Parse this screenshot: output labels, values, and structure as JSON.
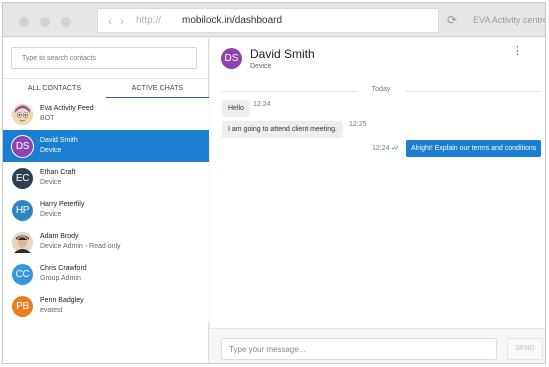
{
  "browser": {
    "back_glyph": "‹",
    "forward_glyph": "›",
    "protocol": "http://",
    "url": "mobilock.in/dashboard",
    "refresh_glyph": "⟳",
    "title": "EVA Activity centre"
  },
  "sidebar": {
    "search_placeholder": "Type to search contacts",
    "tabs": [
      {
        "label": "ALL CONTACTS",
        "active": false
      },
      {
        "label": "ACTIVE CHATS",
        "active": true
      }
    ],
    "contacts": [
      {
        "name": "Eva Activity Feed",
        "subtitle": "BOT",
        "avatar_text": "",
        "avatar_kind": "bot-icon",
        "avatar_color": "#c9a36b",
        "selected": false
      },
      {
        "name": "David Smith",
        "subtitle": "Device",
        "avatar_text": "DS",
        "avatar_color": "#8e44ad",
        "selected": true
      },
      {
        "name": "Ethan Craft",
        "subtitle": "Device",
        "avatar_text": "EC",
        "avatar_color": "#2c3e50",
        "selected": false
      },
      {
        "name": "Harry Peterfily",
        "subtitle": "Device",
        "avatar_text": "HP",
        "avatar_color": "#2e86c1",
        "selected": false
      },
      {
        "name": "Adam Brody",
        "subtitle": "Device Admin - Read only",
        "avatar_text": "",
        "avatar_kind": "person-photo-icon",
        "avatar_color": "#7a5b4a",
        "selected": false
      },
      {
        "name": "Chris Crawford",
        "subtitle": "Group Admin",
        "avatar_text": "CC",
        "avatar_color": "#3498db",
        "selected": false
      },
      {
        "name": "Penn Badgley",
        "subtitle": "evatest",
        "avatar_text": "PB",
        "avatar_color": "#e67e22",
        "selected": false
      }
    ]
  },
  "chat": {
    "header": {
      "avatar_text": "DS",
      "avatar_color": "#8e44ad",
      "name": "David Smith",
      "subtitle": "Device",
      "menu_glyph": "⋮"
    },
    "day_label": "Today",
    "messages": [
      {
        "direction": "in",
        "text": "Hello",
        "time": "12:24"
      },
      {
        "direction": "in",
        "text": "I am going to attend client meeting.",
        "time": "12:25"
      },
      {
        "direction": "out",
        "text": "Alright! Explain our terms and conditions",
        "time": "12:24",
        "status": "read"
      }
    ],
    "composer": {
      "placeholder": "Type your message...",
      "send_label": "SEND"
    }
  },
  "colors": {
    "accent": "#1a7fd1",
    "tab_underline": "#3a5b8c"
  }
}
